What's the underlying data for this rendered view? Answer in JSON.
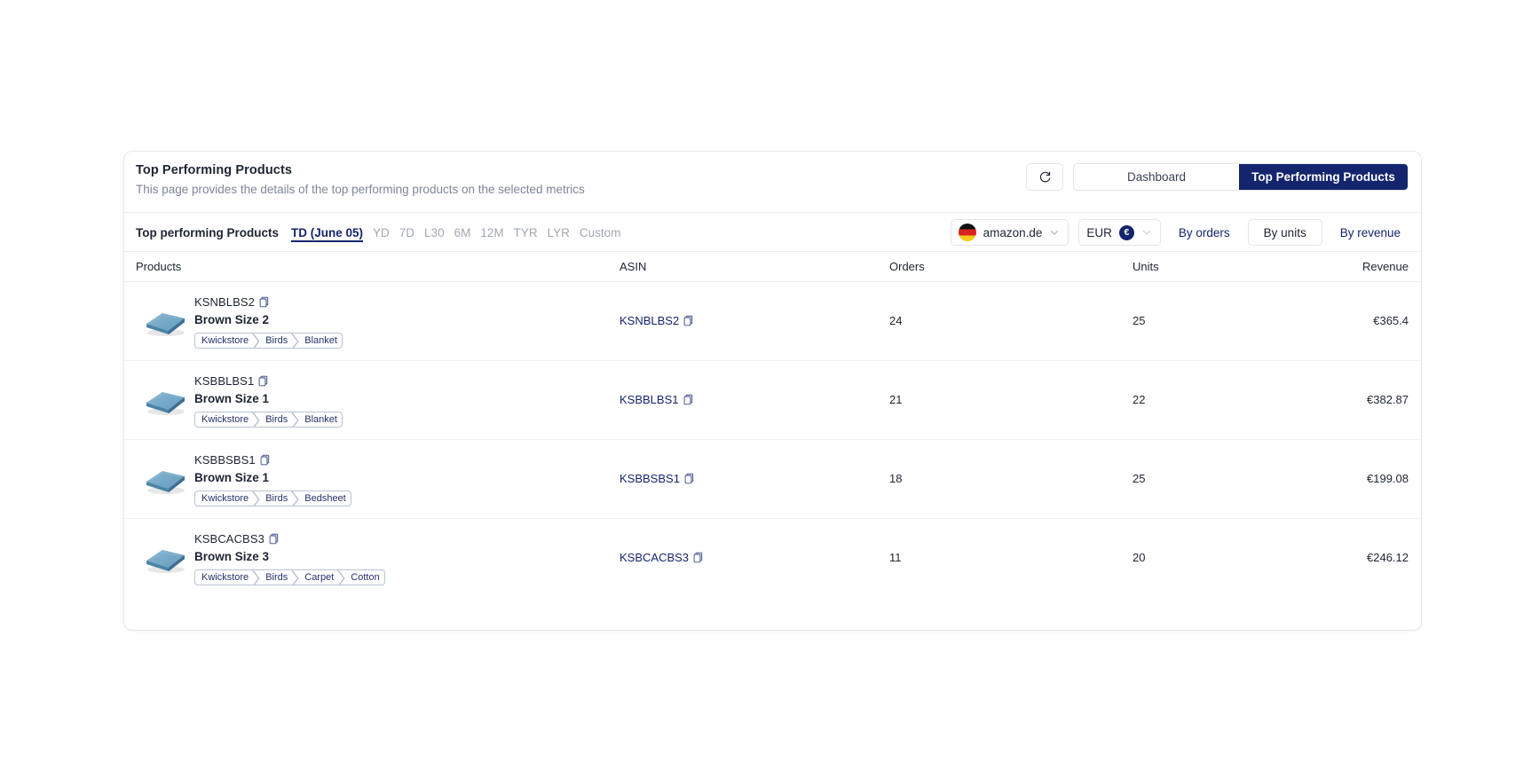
{
  "header": {
    "title": "Top Performing Products",
    "subtitle": "This page provides the details of the top performing products on the selected metrics",
    "refresh_icon": "refresh-icon",
    "tabs": [
      {
        "label": "Dashboard",
        "active": false
      },
      {
        "label": "Top Performing Products",
        "active": true
      }
    ]
  },
  "filters": {
    "section_label": "Top performing Products",
    "ranges": [
      {
        "label": "TD (June 05)",
        "active": true
      },
      {
        "label": "YD",
        "active": false
      },
      {
        "label": "7D",
        "active": false
      },
      {
        "label": "L30",
        "active": false
      },
      {
        "label": "6M",
        "active": false
      },
      {
        "label": "12M",
        "active": false
      },
      {
        "label": "TYR",
        "active": false
      },
      {
        "label": "LYR",
        "active": false
      },
      {
        "label": "Custom",
        "active": false
      }
    ],
    "marketplace": {
      "label": "amazon.de",
      "flag": "germany-flag-icon"
    },
    "currency": {
      "label": "EUR",
      "symbol": "€"
    },
    "metrics": [
      {
        "label": "By orders",
        "boxed": false
      },
      {
        "label": "By units",
        "boxed": true
      },
      {
        "label": "By revenue",
        "boxed": false
      }
    ]
  },
  "table": {
    "columns": [
      "Products",
      "ASIN",
      "Orders",
      "Units",
      "Revenue"
    ],
    "rows": [
      {
        "sku": "KSNBLBS2",
        "name": "Brown Size 2",
        "breadcrumb": [
          "Kwickstore",
          "Birds",
          "Blanket"
        ],
        "asin": "KSNBLBS2",
        "orders": "24",
        "units": "25",
        "revenue": "€365.4"
      },
      {
        "sku": "KSBBLBS1",
        "name": "Brown Size 1",
        "breadcrumb": [
          "Kwickstore",
          "Birds",
          "Blanket"
        ],
        "asin": "KSBBLBS1",
        "orders": "21",
        "units": "22",
        "revenue": "€382.87"
      },
      {
        "sku": "KSBBSBS1",
        "name": "Brown Size 1",
        "breadcrumb": [
          "Kwickstore",
          "Birds",
          "Bedsheet"
        ],
        "asin": "KSBBSBS1",
        "orders": "18",
        "units": "25",
        "revenue": "€199.08"
      },
      {
        "sku": "KSBCACBS3",
        "name": "Brown Size 3",
        "breadcrumb": [
          "Kwickstore",
          "Birds",
          "Carpet",
          "Cotton"
        ],
        "asin": "KSBCACBS3",
        "orders": "11",
        "units": "20",
        "revenue": "€246.12"
      }
    ]
  },
  "colors": {
    "accent_navy": "#14256e",
    "text_primary": "#1d2433",
    "text_muted": "#7d8699",
    "border": "#e2e5ea"
  }
}
